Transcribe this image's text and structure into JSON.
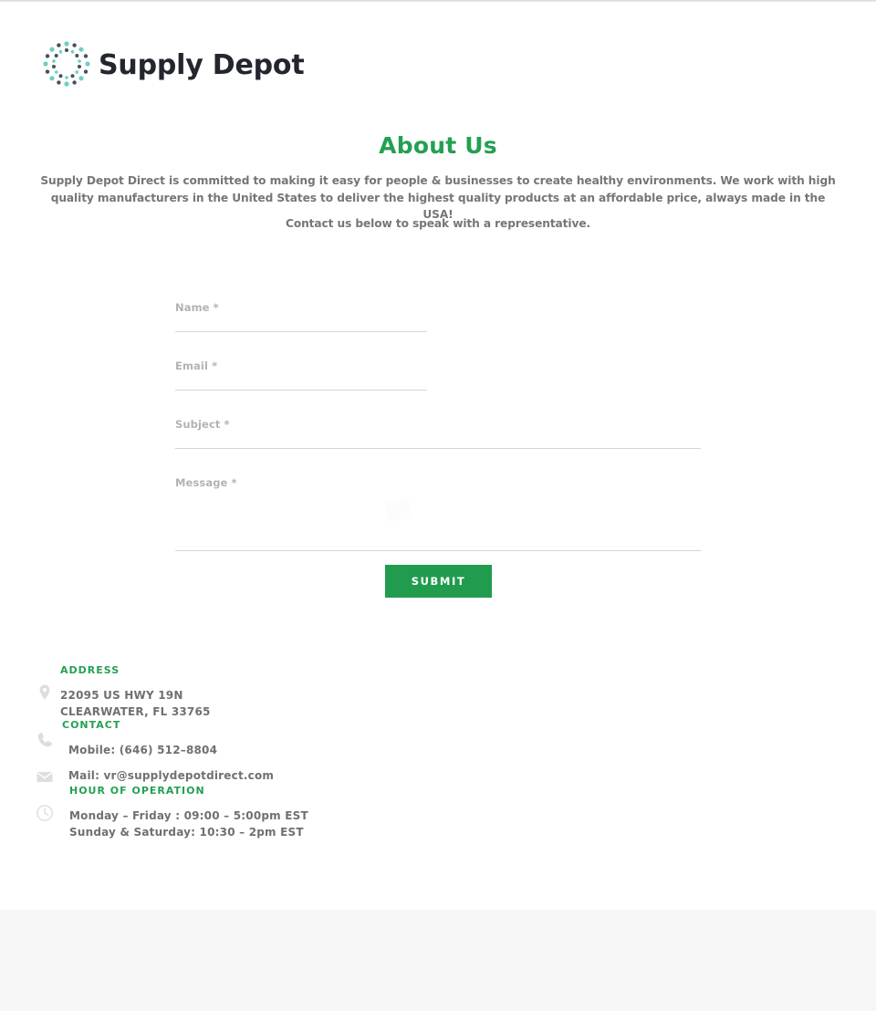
{
  "brand": {
    "name": "Supply Depot",
    "logo_icon": "circular-dots-logo",
    "dot_color_teal": "#6ecfc4",
    "dot_color_dark": "#4a4f5a",
    "wordmark_color": "#23262f"
  },
  "colors": {
    "accent_green": "#23a052",
    "button_green": "#219b4e",
    "body_text": "#767676",
    "label_gray": "#b3b3b3",
    "rule_gray": "#d6d6d6",
    "footer_band": "#f7f7f7"
  },
  "about": {
    "title": "About Us",
    "paragraph": "Supply Depot Direct is committed to making it easy for people & businesses to create healthy environments. We work with high quality manufacturers in the United States to deliver the highest quality products at an affordable price, always made in the USA!",
    "cta": "Contact us below to speak with a representative."
  },
  "form": {
    "fields": [
      {
        "label": "Name *",
        "value": "",
        "placeholder": ""
      },
      {
        "label": "Email *",
        "value": "",
        "placeholder": ""
      },
      {
        "label": "Subject *",
        "value": "",
        "placeholder": ""
      },
      {
        "label": "Message *",
        "value": "",
        "placeholder": ""
      }
    ],
    "submit_label": "SUBMIT"
  },
  "contact": {
    "address": {
      "heading": "ADDRESS",
      "icon": "map-pin-icon",
      "line1": "22095 US HWY 19N",
      "line2": "CLEARWATER, FL 33765"
    },
    "phone": {
      "heading": "CONTACT",
      "icon": "phone-icon",
      "mobile": "Mobile: (646) 512–8804"
    },
    "email": {
      "icon": "mail-icon",
      "mail": "Mail: vr@supplydepotdirect.com"
    },
    "hours": {
      "heading": "HOUR OF OPERATION",
      "icon": "clock-icon",
      "weekday": "Monday – Friday : 09:00 – 5:00pm EST",
      "weekend": "Sunday & Saturday: 10:30 – 2pm EST"
    }
  }
}
